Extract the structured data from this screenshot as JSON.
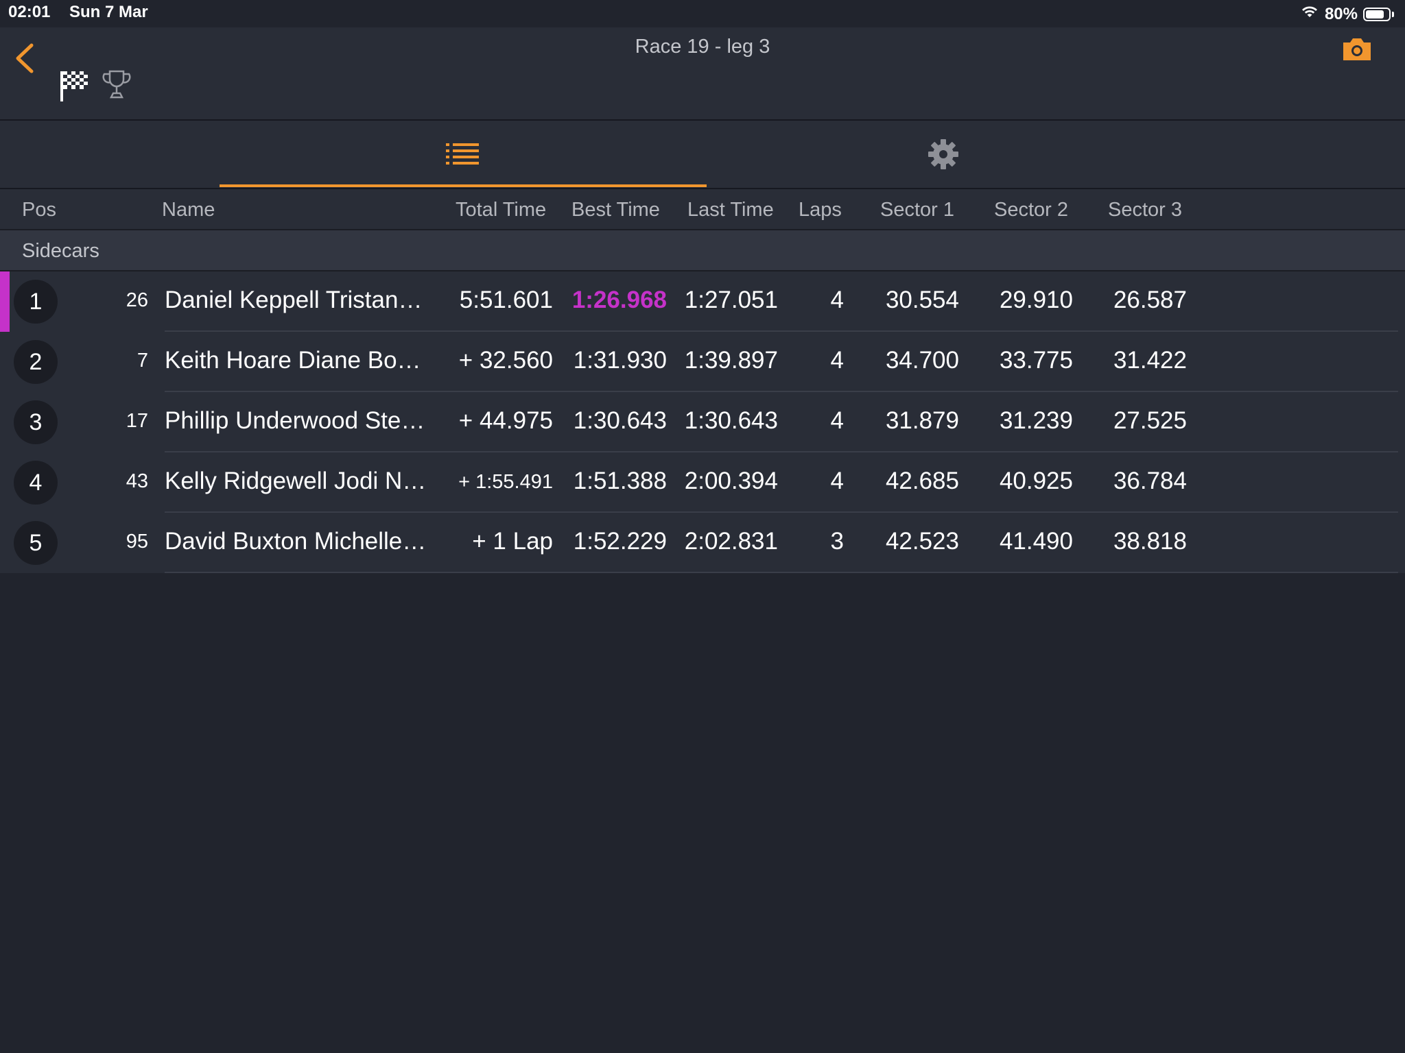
{
  "status_bar": {
    "time": "02:01",
    "date": "Sun 7 Mar",
    "battery_percent": "80%",
    "battery_level": 0.8
  },
  "header": {
    "title": "Race 19  - leg 3",
    "back_icon": "chevron-left-icon",
    "flag_icon": "checkered-flag-icon",
    "trophy_icon": "trophy-icon",
    "camera_icon": "camera-icon"
  },
  "tabs": [
    {
      "icon": "list-icon",
      "selected": true
    },
    {
      "icon": "gear-icon",
      "selected": false
    }
  ],
  "colors": {
    "accent": "#f1962e",
    "fastest_lap": "#c532c9",
    "background": "#21242d",
    "row_background": "#292d37"
  },
  "table": {
    "columns": [
      "Pos",
      "Name",
      "Total Time",
      "Best Time",
      "Last Time",
      "Laps",
      "Sector 1",
      "Sector 2",
      "Sector 3"
    ],
    "group": "Sidecars",
    "rows": [
      {
        "pos": "1",
        "number": "26",
        "name": "Daniel Keppell Tristan…",
        "total": "5:51.601",
        "best": "1:26.968",
        "last": "1:27.051",
        "laps": "4",
        "s1": "30.554",
        "s2": "29.910",
        "s3": "26.587"
      },
      {
        "pos": "2",
        "number": "7",
        "name": "Keith Hoare Diane Bo…",
        "total": "+ 32.560",
        "best": "1:31.930",
        "last": "1:39.897",
        "laps": "4",
        "s1": "34.700",
        "s2": "33.775",
        "s3": "31.422"
      },
      {
        "pos": "3",
        "number": "17",
        "name": "Phillip Underwood Ste…",
        "total": "+ 44.975",
        "best": "1:30.643",
        "last": "1:30.643",
        "laps": "4",
        "s1": "31.879",
        "s2": "31.239",
        "s3": "27.525"
      },
      {
        "pos": "4",
        "number": "43",
        "name": "Kelly Ridgewell Jodi N…",
        "total": "+ 1:55.491",
        "best": "1:51.388",
        "last": "2:00.394",
        "laps": "4",
        "s1": "42.685",
        "s2": "40.925",
        "s3": "36.784"
      },
      {
        "pos": "5",
        "number": "95",
        "name": "David Buxton Michelle…",
        "total": "+ 1 Lap",
        "best": "1:52.229",
        "last": "2:02.831",
        "laps": "3",
        "s1": "42.523",
        "s2": "41.490",
        "s3": "38.818"
      }
    ]
  }
}
